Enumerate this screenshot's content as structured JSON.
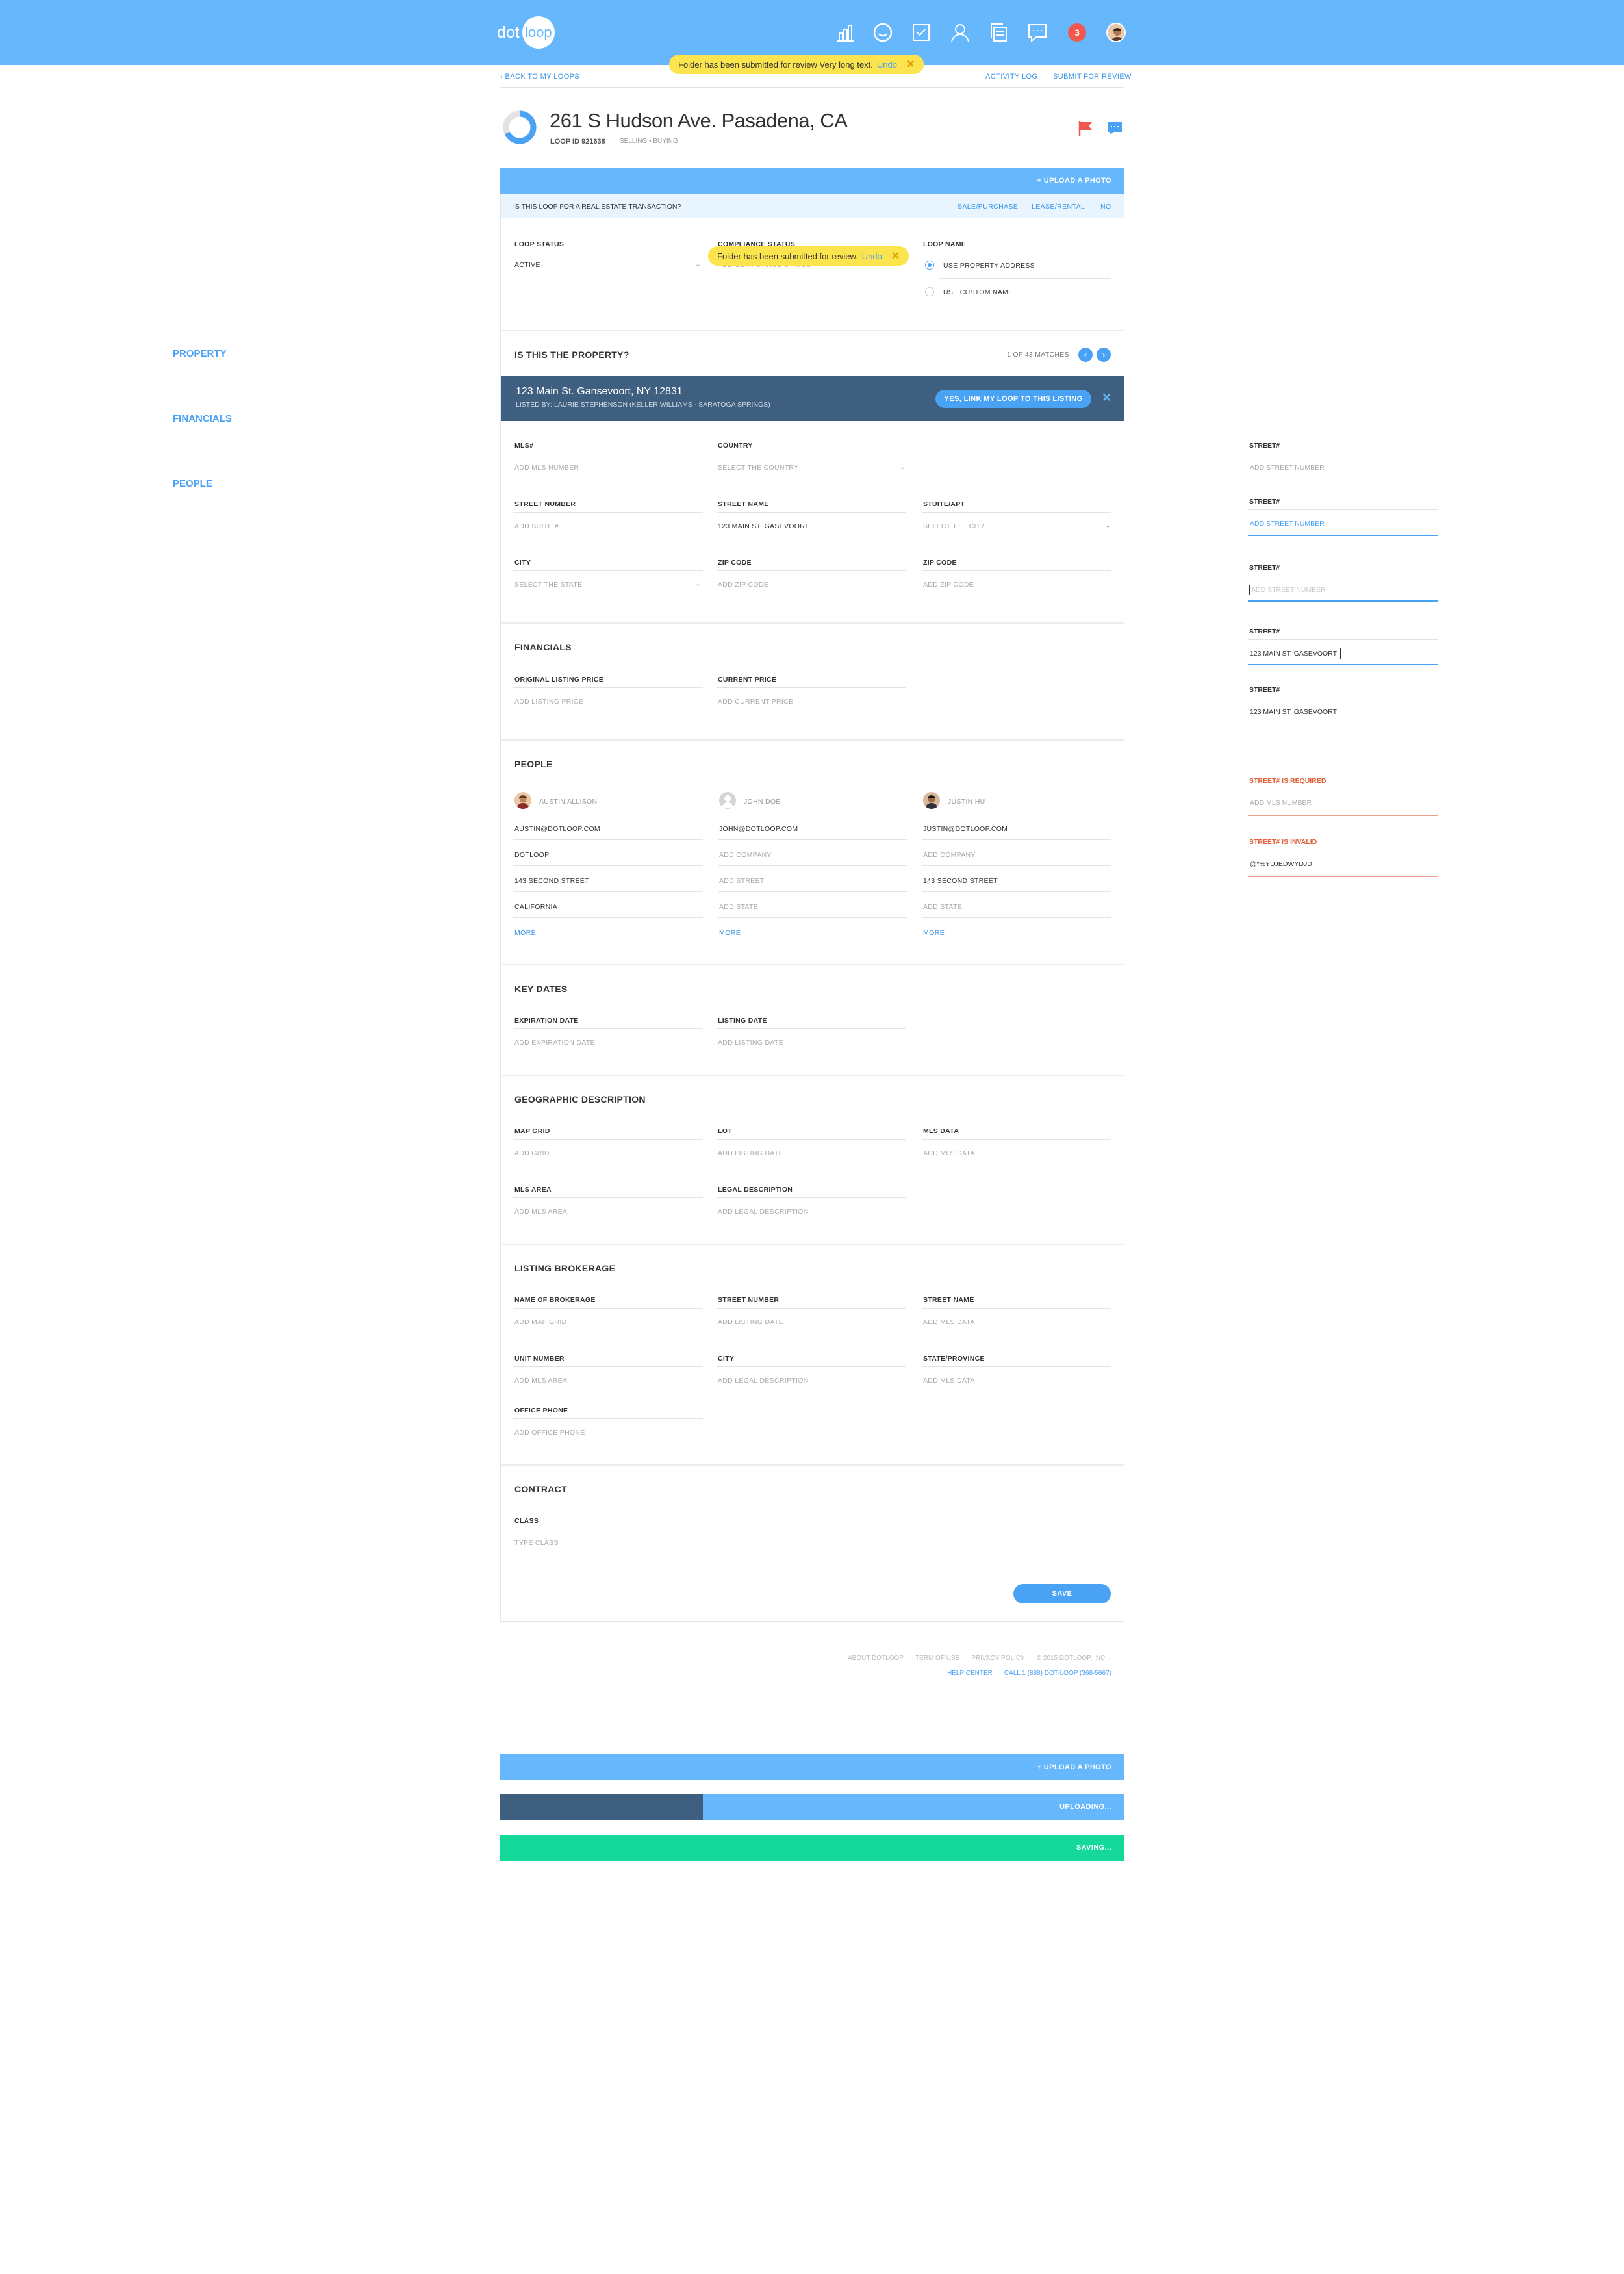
{
  "header": {
    "logo_dot": "dot",
    "logo_loop": "loop",
    "notification_count": "3",
    "nav_icons": [
      "chart-icon",
      "smile-icon",
      "checklist-icon",
      "person-icon",
      "documents-icon",
      "chat-icon"
    ]
  },
  "subnav": {
    "back": "‹ BACK TO MY LOOPS",
    "activity_log": "ACTIVITY LOG",
    "submit_review": "SUBMIT FOR REVIEW"
  },
  "toast_top": {
    "text": "Folder has been submitted for review Very long text.",
    "undo": "Undo",
    "close": "✕"
  },
  "toast_mid": {
    "text": "Folder has been submitted for review.",
    "undo": "Undo",
    "close": "✕"
  },
  "loop": {
    "title": "261 S Hudson Ave. Pasadena, CA",
    "id": "LOOP ID 921638",
    "meta": "SELLING • BUYING"
  },
  "upload_photo": "+ UPLOAD A PHOTO",
  "transaction": {
    "question": "IS THIS LOOP FOR A REAL ESTATE TRANSACTION?",
    "options": [
      "SALE/PURCHASE",
      "LEASE/RENTAL",
      "NO"
    ]
  },
  "status": {
    "loop_status_label": "LOOP STATUS",
    "loop_status_value": "ACTIVE",
    "compliance_label": "COMPLIANCE STATUS",
    "compliance_value": "ADD COMPLIANCE STATUS",
    "loop_name_label": "LOOP NAME",
    "use_property": "USE PROPERTY ADDRESS",
    "use_custom": "USE CUSTOM NAME"
  },
  "sidenav": [
    "PROPERTY",
    "FINANCIALS",
    "PEOPLE"
  ],
  "match": {
    "question": "IS THIS THE PROPERTY?",
    "count": "1 OF 43 MATCHES",
    "address": "123 Main St. Gansevoort, NY 12831",
    "listed_by": "LISTED BY: LAURIE STEPHENSON (KELLER WILLIAMS - SARATOGA SPRINGS)",
    "link_button": "YES, LINK MY LOOP TO THIS LISTING"
  },
  "property_fields": [
    {
      "label": "MLS#",
      "value": "ADD MLS NUMBER"
    },
    {
      "label": "COUNTRY",
      "value": "SELECT THE COUNTRY"
    },
    {
      "label": "STREET NUMBER",
      "value": "ADD SUITE #"
    },
    {
      "label": "STREET NAME",
      "value": "123 MAIN ST, GASEVOORT"
    },
    {
      "label": "STUITE/APT",
      "value": "SELECT THE CITY"
    },
    {
      "label": "CITY",
      "value": "SELECT THE STATE"
    },
    {
      "label": "ZIP CODE",
      "value": "ADD ZIP CODE"
    },
    {
      "label": "ZIP CODE",
      "value": "ADD ZIP CODE"
    }
  ],
  "financials": {
    "title": "FINANCIALS",
    "fields": [
      {
        "label": "ORIGINAL LISTING PRICE",
        "value": "ADD LISTING PRICE"
      },
      {
        "label": "CURRENT PRICE",
        "value": "ADD CURRENT PRICE"
      }
    ]
  },
  "people": {
    "title": "PEOPLE",
    "persons": [
      {
        "name": "AUSTIN ALLISON",
        "email": "AUSTIN@DOTLOOP.COM",
        "company": "DOTLOOP",
        "street": "143 SECOND STREET",
        "state": "CALIFORNIA",
        "more": "MORE"
      },
      {
        "name": "JOHN DOE",
        "email": "JOHN@DOTLOOP.COM",
        "company": "ADD COMPANY",
        "street": "ADD STREET",
        "state": "ADD STATE",
        "more": "MORE"
      },
      {
        "name": "JUSTIN HU",
        "email": "JUSTIN@DOTLOOP.COM",
        "company": "ADD COMPANY",
        "street": "143 SECOND STREET",
        "state": "ADD STATE",
        "more": "MORE"
      }
    ]
  },
  "key_dates": {
    "title": "KEY DATES",
    "fields": [
      {
        "label": "EXPIRATION DATE",
        "value": "ADD EXPIRATION DATE"
      },
      {
        "label": "LISTING DATE",
        "value": "ADD LISTING DATE"
      }
    ]
  },
  "geo": {
    "title": "GEOGRAPHIC DESCRIPTION",
    "fields": [
      {
        "label": "MAP GRID",
        "value": "ADD GRID"
      },
      {
        "label": "LOT",
        "value": "ADD LISTING DATE"
      },
      {
        "label": "MLS DATA",
        "value": "ADD MLS DATA"
      },
      {
        "label": "MLS AREA",
        "value": "ADD MLS AREA"
      },
      {
        "label": "LEGAL DESCRIPTION",
        "value": "ADD LEGAL DESCRIPTION"
      }
    ]
  },
  "brokerage": {
    "title": "LISTING BROKERAGE",
    "fields": [
      {
        "label": "NAME OF BROKERAGE",
        "value": "ADD MAP GRID"
      },
      {
        "label": "STREET NUMBER",
        "value": "ADD LISTING DATE"
      },
      {
        "label": "STREET NAME",
        "value": "ADD MLS DATA"
      },
      {
        "label": "UNIT NUMBER",
        "value": "ADD MLS AREA"
      },
      {
        "label": "CITY",
        "value": "ADD LEGAL DESCRIPTION"
      },
      {
        "label": "STATE/PROVINCE",
        "value": "ADD MLS DATA"
      },
      {
        "label": "OFFICE PHONE",
        "value": "ADD OFFICE PHONE"
      }
    ]
  },
  "contract": {
    "title": "CONTRACT",
    "fields": [
      {
        "label": "CLASS",
        "value": "TYPE CLASS"
      }
    ],
    "save": "SAVE"
  },
  "footer": {
    "about": "ABOUT DOTLOOP",
    "terms": "TERM OF USE",
    "privacy": "PRIVACY POLICY",
    "copyright": "© 2015 DOTLOOP, INC",
    "help": "HELP CENTER",
    "call": "CALL 1 (888) DOT-LOOP (368-5667)"
  },
  "states": {
    "upload": "+ UPLOAD A PHOTO",
    "uploading": "UPLOADING...",
    "saving": "SAVING...",
    "uploading_progress_pct": 32.5
  },
  "right_panel": [
    {
      "label": "STREET#",
      "value": "ADD STREET NUMBER",
      "state": "default"
    },
    {
      "label": "STREET#",
      "value": "ADD STREET NUMBER",
      "state": "hover"
    },
    {
      "label": "STREET#",
      "value": "ADD STREET NUMBER",
      "state": "focus"
    },
    {
      "label": "STREET#",
      "value": "123 MAIN ST, GASEVOORT",
      "state": "typing"
    },
    {
      "label": "STREET#",
      "value": "123 MAIN ST, GASEVOORT",
      "state": "filled"
    },
    {
      "label": "STREET# IS REQUIRED",
      "value": "ADD MLS NUMBER",
      "state": "error"
    },
    {
      "label": "STREET# IS INVALID",
      "value": "@*%YUJEDWYDJD",
      "state": "error"
    }
  ],
  "colors": {
    "primary": "#66b7fc",
    "accent": "#4aa2f5",
    "dark": "#3e5f7f",
    "success": "#14d99a",
    "toast": "#fce44f",
    "error": "#e0613b"
  }
}
